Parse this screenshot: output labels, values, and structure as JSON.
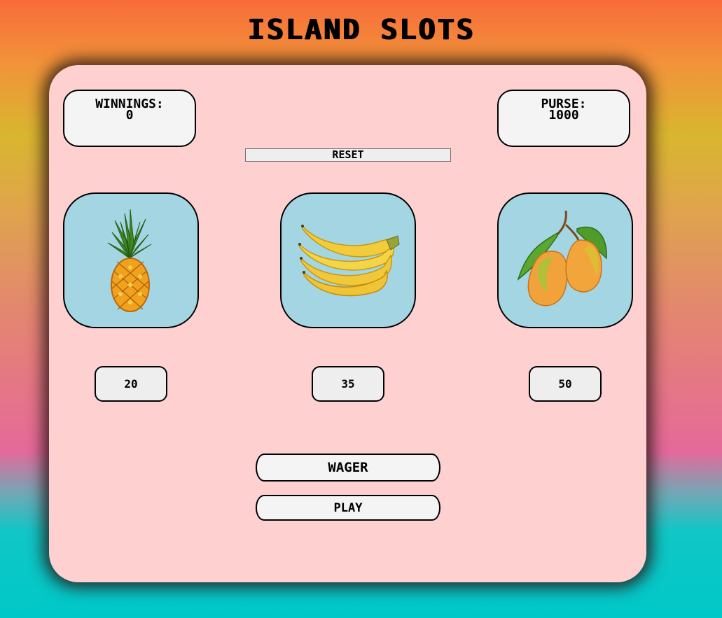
{
  "title": "ISLAND SLOTS",
  "winnings": {
    "label": "WINNINGS:",
    "value": "0"
  },
  "purse": {
    "label": "PURSE:",
    "value": "1000"
  },
  "reset_label": "RESET",
  "reels": [
    {
      "icon": "pineapple-icon"
    },
    {
      "icon": "banana-icon"
    },
    {
      "icon": "mango-icon"
    }
  ],
  "bets": [
    "20",
    "35",
    "50"
  ],
  "wager_label": "WAGER",
  "play_label": "PLAY",
  "colors": {
    "panel": "#ffd0d0",
    "reel_bg": "#a3d5e2",
    "button_bg": "#eeeeee",
    "gradient_top": "#f86c3a",
    "gradient_bottom": "#00c8c8"
  }
}
